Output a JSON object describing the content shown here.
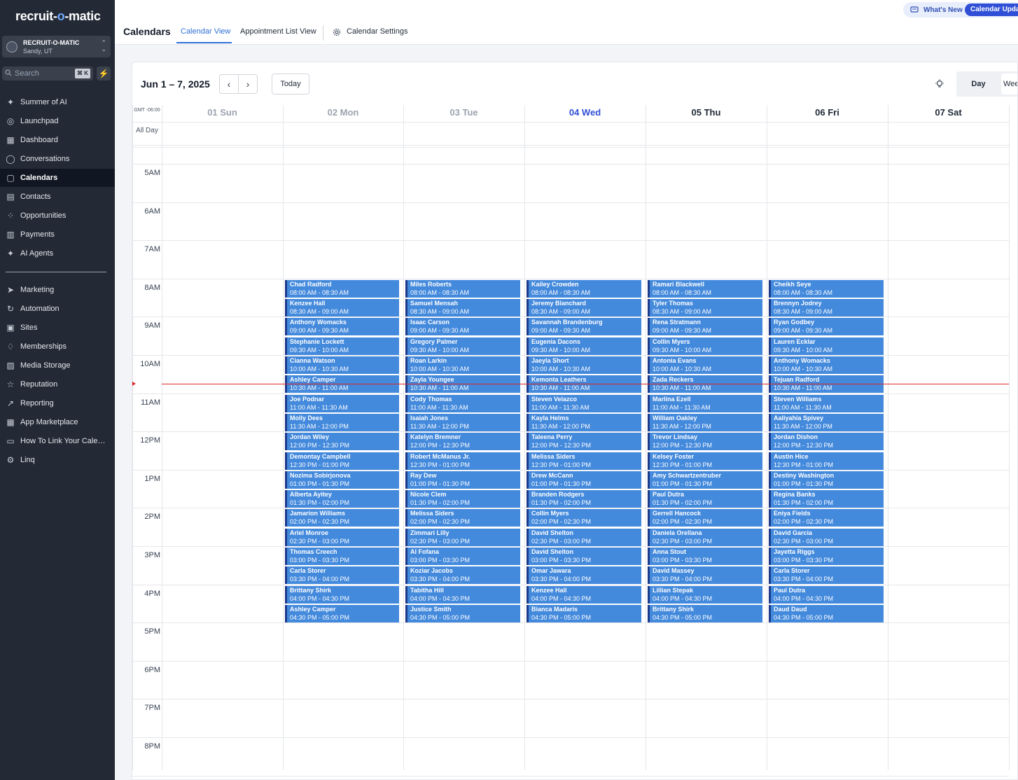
{
  "brand": {
    "logo_text_a": "recruit-",
    "logo_text_b": "o",
    "logo_text_c": "-matic"
  },
  "account": {
    "name": "RECRUIT-O-MATIC",
    "location": "Sandy, UT"
  },
  "search": {
    "placeholder": "Search",
    "shortcut": "⌘ K"
  },
  "sidebar": {
    "items": [
      {
        "label": "Summer of AI",
        "icon": "sparkle-icon"
      },
      {
        "label": "Launchpad",
        "icon": "rocket-icon"
      },
      {
        "label": "Dashboard",
        "icon": "grid-icon"
      },
      {
        "label": "Conversations",
        "icon": "chat-icon"
      },
      {
        "label": "Calendars",
        "icon": "calendar-icon"
      },
      {
        "label": "Contacts",
        "icon": "contacts-icon"
      },
      {
        "label": "Opportunities",
        "icon": "opportunities-icon"
      },
      {
        "label": "Payments",
        "icon": "payments-icon"
      },
      {
        "label": "AI Agents",
        "icon": "sparkle-icon"
      }
    ],
    "items2": [
      {
        "label": "Marketing",
        "icon": "send-icon"
      },
      {
        "label": "Automation",
        "icon": "automation-icon"
      },
      {
        "label": "Sites",
        "icon": "sites-icon"
      },
      {
        "label": "Memberships",
        "icon": "membership-icon"
      },
      {
        "label": "Media Storage",
        "icon": "image-icon"
      },
      {
        "label": "Reputation",
        "icon": "star-icon"
      },
      {
        "label": "Reporting",
        "icon": "chart-icon"
      },
      {
        "label": "App Marketplace",
        "icon": "apps-icon"
      },
      {
        "label": "How To Link Your Calen...",
        "icon": "link-icon"
      },
      {
        "label": "Linq",
        "icon": "gear-icon"
      }
    ]
  },
  "header": {
    "title": "Calendars",
    "tabs": [
      "Calendar View",
      "Appointment List View",
      "Calendar Settings"
    ],
    "whats_new": "What's New",
    "calendar_update": "Calendar Update"
  },
  "toolbar": {
    "range": "Jun 1 – 7, 2025",
    "today": "Today",
    "day": "Day",
    "week": "Wee"
  },
  "grid": {
    "gmt": "GMT -06:00",
    "all_day": "All Day",
    "days": [
      "01 Sun",
      "02 Mon",
      "03 Tue",
      "04 Wed",
      "05 Thu",
      "06 Fri",
      "07 Sat"
    ],
    "hours": [
      "5AM",
      "6AM",
      "7AM",
      "8AM",
      "9AM",
      "10AM",
      "11AM",
      "12PM",
      "1PM",
      "2PM",
      "3PM",
      "4PM",
      "5PM",
      "6PM",
      "7PM",
      "8PM"
    ]
  },
  "slots": [
    "08:00 AM - 08:30 AM",
    "08:30 AM - 09:00 AM",
    "09:00 AM - 09:30 AM",
    "09:30 AM - 10:00 AM",
    "10:00 AM - 10:30 AM",
    "10:30 AM - 11:00 AM",
    "11:00 AM - 11:30 AM",
    "11:30 AM - 12:00 PM",
    "12:00 PM - 12:30 PM",
    "12:30 PM - 01:00 PM",
    "01:00 PM - 01:30 PM",
    "01:30 PM - 02:00 PM",
    "02:00 PM - 02:30 PM",
    "02:30 PM - 03:00 PM",
    "03:00 PM - 03:30 PM",
    "03:30 PM - 04:00 PM",
    "04:00 PM - 04:30 PM",
    "04:30 PM - 05:00 PM"
  ],
  "appointments": {
    "mon": [
      "Chad Radford",
      "Kenzee Hall",
      "Anthony Womacks",
      "Stephanie Lockett",
      "Cianna Watson",
      "Ashley  Camper",
      "Joe Podnar",
      "Molly Dees",
      "Jordan  Wiley",
      "Demontay  Campbell",
      "Nozima Sobirjonova",
      "Alberta  Ayitey",
      "Jamarion Williams",
      "Ariel Monroe",
      "Thomas Creech",
      "Carla Storer",
      "Brittany Shirk",
      "Ashley Camper"
    ],
    "tue": [
      "Miles Roberts",
      "Samuel Mensah",
      "Isaac Carson",
      "Gregory  Palmer",
      "Roan Larkin",
      "Zayla Youngee",
      "Cody Thomas",
      "Isaiah Jones",
      "Katelyn Bremner",
      "Robert McManus Jr.",
      "Ray Dew",
      "Nicole  Clem",
      "Melissa Siders",
      "Zimmari Lilly",
      "Al Fofana",
      "Koziar Jacobs",
      "Tabitha Hill",
      "Justice  Smith"
    ],
    "wed": [
      "Kailey Crowden",
      "Jeremy Blanchard",
      "Savannah  Brandenburg",
      "Eugenia  Dacons",
      "Jaeyla  Short",
      "Kemonta Leathers",
      "Steven  Velazco",
      "Kayla Helms",
      "Taleena Perry",
      "Melissa Siders",
      "Drew  McCann",
      "Branden Rodgers",
      "Collin Myers",
      "David  Shelton",
      "David  Shelton",
      "Omar Jawara",
      "Kenzee Hall",
      "Bianca  Madaris"
    ],
    "thu": [
      "Ramari Blackwell",
      "Tyler Thomas",
      "Rena Stratmann",
      "Collin Myers",
      "Antonia Evans",
      "Zada Reckers",
      "Marlina Ezell",
      "William Oakley",
      "Trevor  Lindsay",
      "Kelsey Foster",
      "Amy Schwartzentruber",
      "Paul Dutra",
      "Gerrell Hancock",
      "Daniela Orellana",
      "Anna Stout",
      "David  Massey",
      "Lillian Stepak",
      "Brittany Shirk"
    ],
    "fri": [
      "Cheikh  Seye",
      "Brennyn Jodrey",
      "Ryan Godbey",
      "Lauren Ecklar",
      "Anthony Womacks",
      "Tejuan  Radford",
      "Steven  Williams",
      "Aaliyahia Spivey",
      "Jordan Dishon",
      "Austin  Hice",
      "Destiny Washington",
      "Regina Banks",
      "Eniya Fields",
      "David  Garcia",
      "Jayetta  Riggs",
      "Carla Storer",
      "Paul Dutra",
      "Daud Daud"
    ]
  },
  "colors": {
    "event_bg": "#4389dc",
    "event_border": "#1e3a8a",
    "today_color": "#2f4fd6",
    "now_line": "#dc2626",
    "sidebar_bg": "#232a36"
  }
}
